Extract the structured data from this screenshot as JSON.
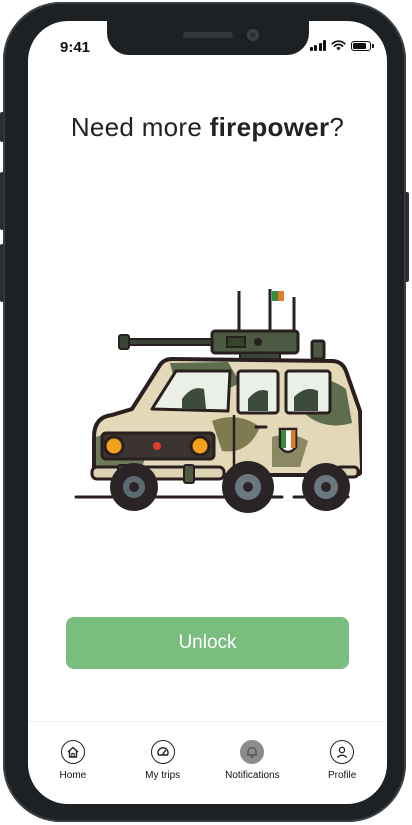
{
  "status_bar": {
    "time": "9:41",
    "battery_level": 0.85
  },
  "headline": {
    "prefix": "Need more ",
    "emphasis": "firepower",
    "suffix": "?"
  },
  "illustration": {
    "subject": "camouflaged military car with mounted machine gun",
    "flag_colors": [
      "#3a8a3a",
      "#ffffff",
      "#e07a2c"
    ]
  },
  "unlock_button": {
    "label": "Unlock",
    "color": "#79bd7f"
  },
  "bottom_nav": {
    "items": [
      {
        "label": "Home",
        "icon": "home-icon",
        "active": false
      },
      {
        "label": "My trips",
        "icon": "speedometer-icon",
        "active": false
      },
      {
        "label": "Notifications",
        "icon": "bell-icon",
        "active": true
      },
      {
        "label": "Profile",
        "icon": "profile-icon",
        "active": false
      }
    ]
  }
}
